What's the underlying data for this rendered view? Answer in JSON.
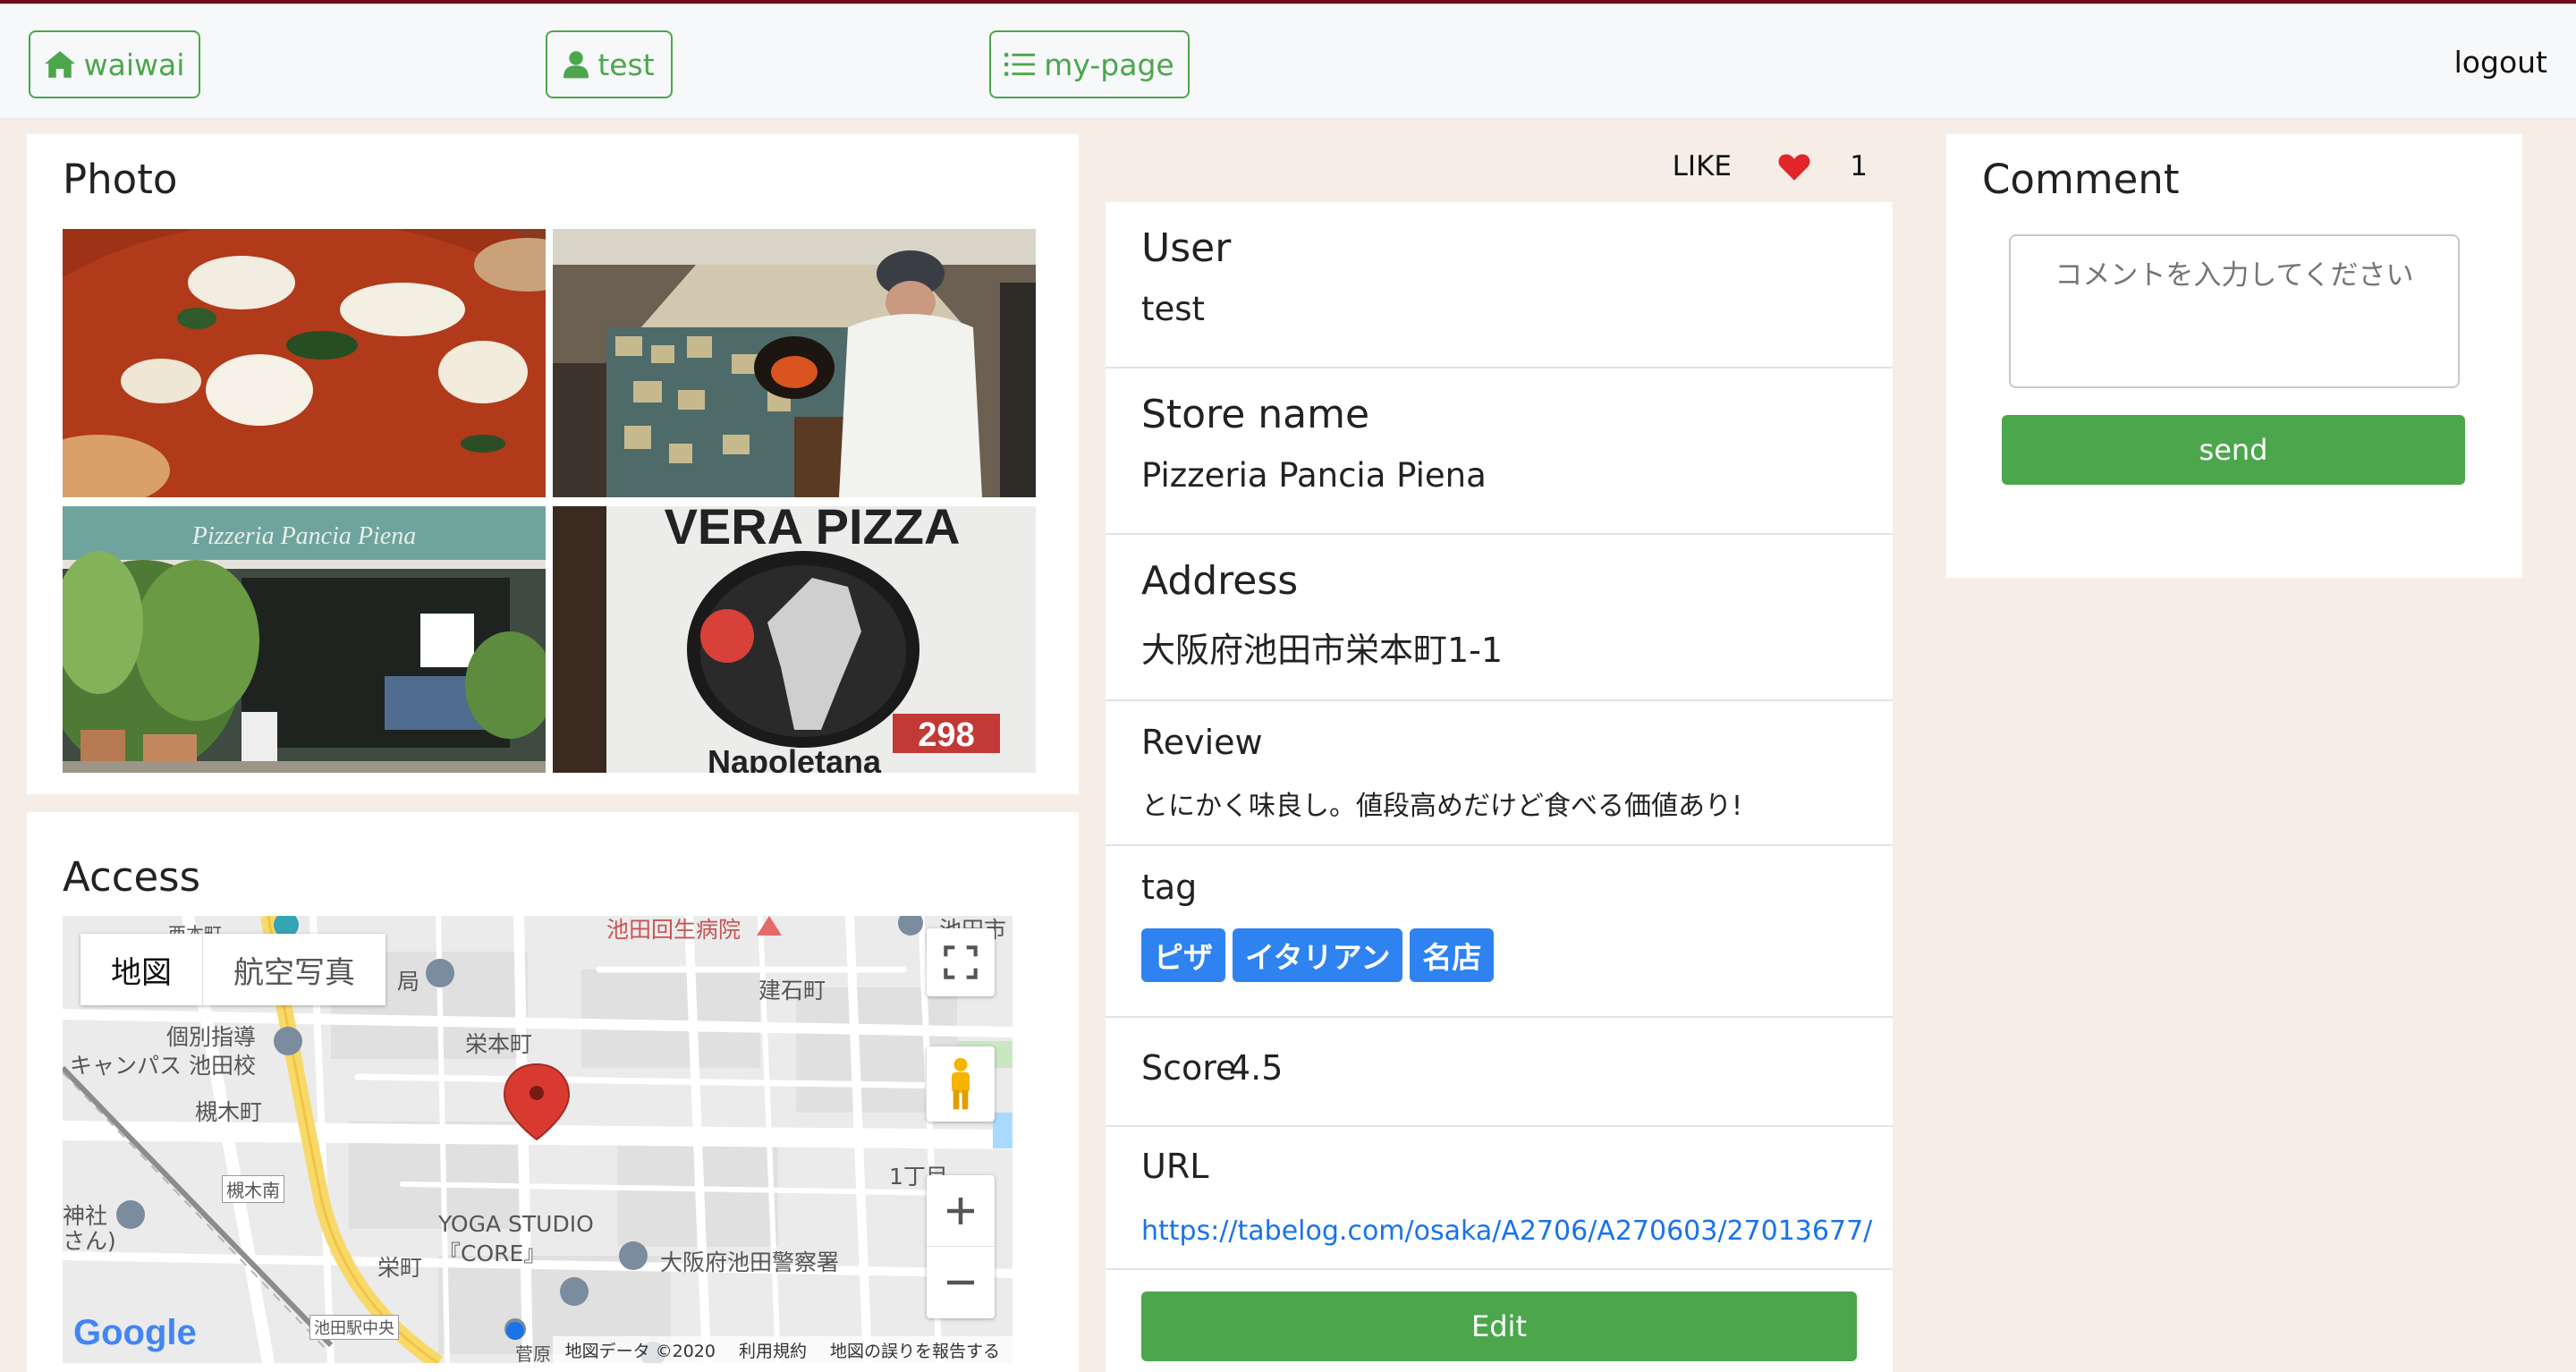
{
  "nav": {
    "home_label": "waiwai",
    "user_label": "test",
    "mypage_label": "my-page",
    "logout_label": "logout"
  },
  "photo": {
    "title": "Photo",
    "images": [
      {
        "name": "pizza-photo"
      },
      {
        "name": "oven-chef-photo"
      },
      {
        "name": "storefront-photo"
      },
      {
        "name": "sign-photo",
        "sign_text_top": "VERA PIZZA",
        "sign_number": "298",
        "sign_text_bottom": "Napoletana",
        "storefront_sign": "Pizzeria Pancia Piena"
      }
    ]
  },
  "access": {
    "title": "Access",
    "map": {
      "tab_map": "地図",
      "tab_satellite": "航空写真",
      "labels": {
        "l1": "池田回生病院",
        "l2": "池田市",
        "l3": "西本町",
        "l4": "局",
        "l5": "建石町",
        "l6": "個別指導",
        "l7": "キャンパス 池田校",
        "l8": "栄本町",
        "l9": "槻木町",
        "l10": "槻木南",
        "l11": "1丁目",
        "l12": "神社",
        "l13": "さん)",
        "l14": "YOGA STUDIO",
        "l15": "『CORE』",
        "l16": "大阪府池田警察署",
        "l17": "栄町",
        "l18": "池田駅中央",
        "l19": "菅原"
      },
      "logo": "Google",
      "footer_data": "地図データ ©2020",
      "footer_terms": "利用規約",
      "footer_report": "地図の誤りを報告する"
    }
  },
  "like": {
    "label": "LIKE",
    "count": "1"
  },
  "details": {
    "user_label": "User",
    "user_value": "test",
    "store_label": "Store name",
    "store_value": "Pizzeria Pancia Piena",
    "address_label": "Address",
    "address_value": "大阪府池田市栄本町1-1",
    "review_label": "Review",
    "review_value": "とにかく味良し。値段高めだけど食べる価値あり!",
    "tag_label": "tag",
    "tags": [
      "ピザ",
      "イタリアン",
      "名店"
    ],
    "score_label": "Score",
    "score_value": "4.5",
    "url_label": "URL",
    "url_value": "https://tabelog.com/osaka/A2706/A270603/27013677/",
    "edit_label": "Edit"
  },
  "comment": {
    "title": "Comment",
    "placeholder": "コメントを入力してください",
    "send_label": "send"
  },
  "colors": {
    "accent_green": "#4ca64c",
    "tag_blue": "#2e83f0",
    "link_blue": "#1a73e8",
    "page_bg": "#f6eee6",
    "heart_red": "#e2252b"
  }
}
